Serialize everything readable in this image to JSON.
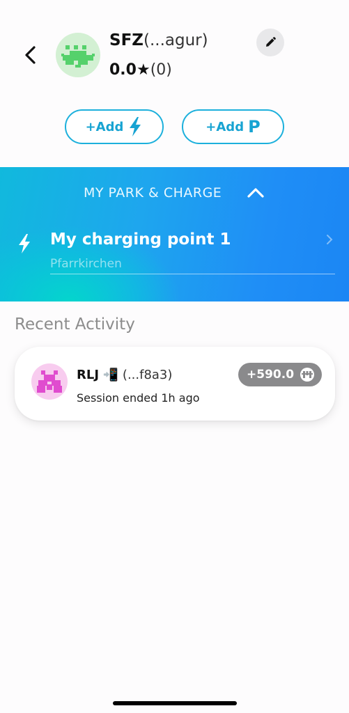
{
  "header": {
    "short_name": "SFZ",
    "address": "(...agur)",
    "rating": "0.0★",
    "rating_count": "(0)"
  },
  "actions": {
    "add_charge_label": "+Add",
    "add_park_label": "+Add",
    "park_letter": "P"
  },
  "park_panel": {
    "title": "MY PARK & CHARGE",
    "charging_point": {
      "name": "My charging point 1",
      "location": "Pfarrkirchen"
    }
  },
  "recent": {
    "title": "Recent Activity",
    "items": [
      {
        "user": "RLJ",
        "emoji": "📲",
        "address": "(...f8a3)",
        "status": "Session ended 1h ago",
        "amount": "+590.0"
      }
    ]
  },
  "colors": {
    "accent": "#17a3d2",
    "panel_start": "#11b9dd",
    "panel_end": "#1b86f4",
    "badge": "#8a8a8c"
  }
}
